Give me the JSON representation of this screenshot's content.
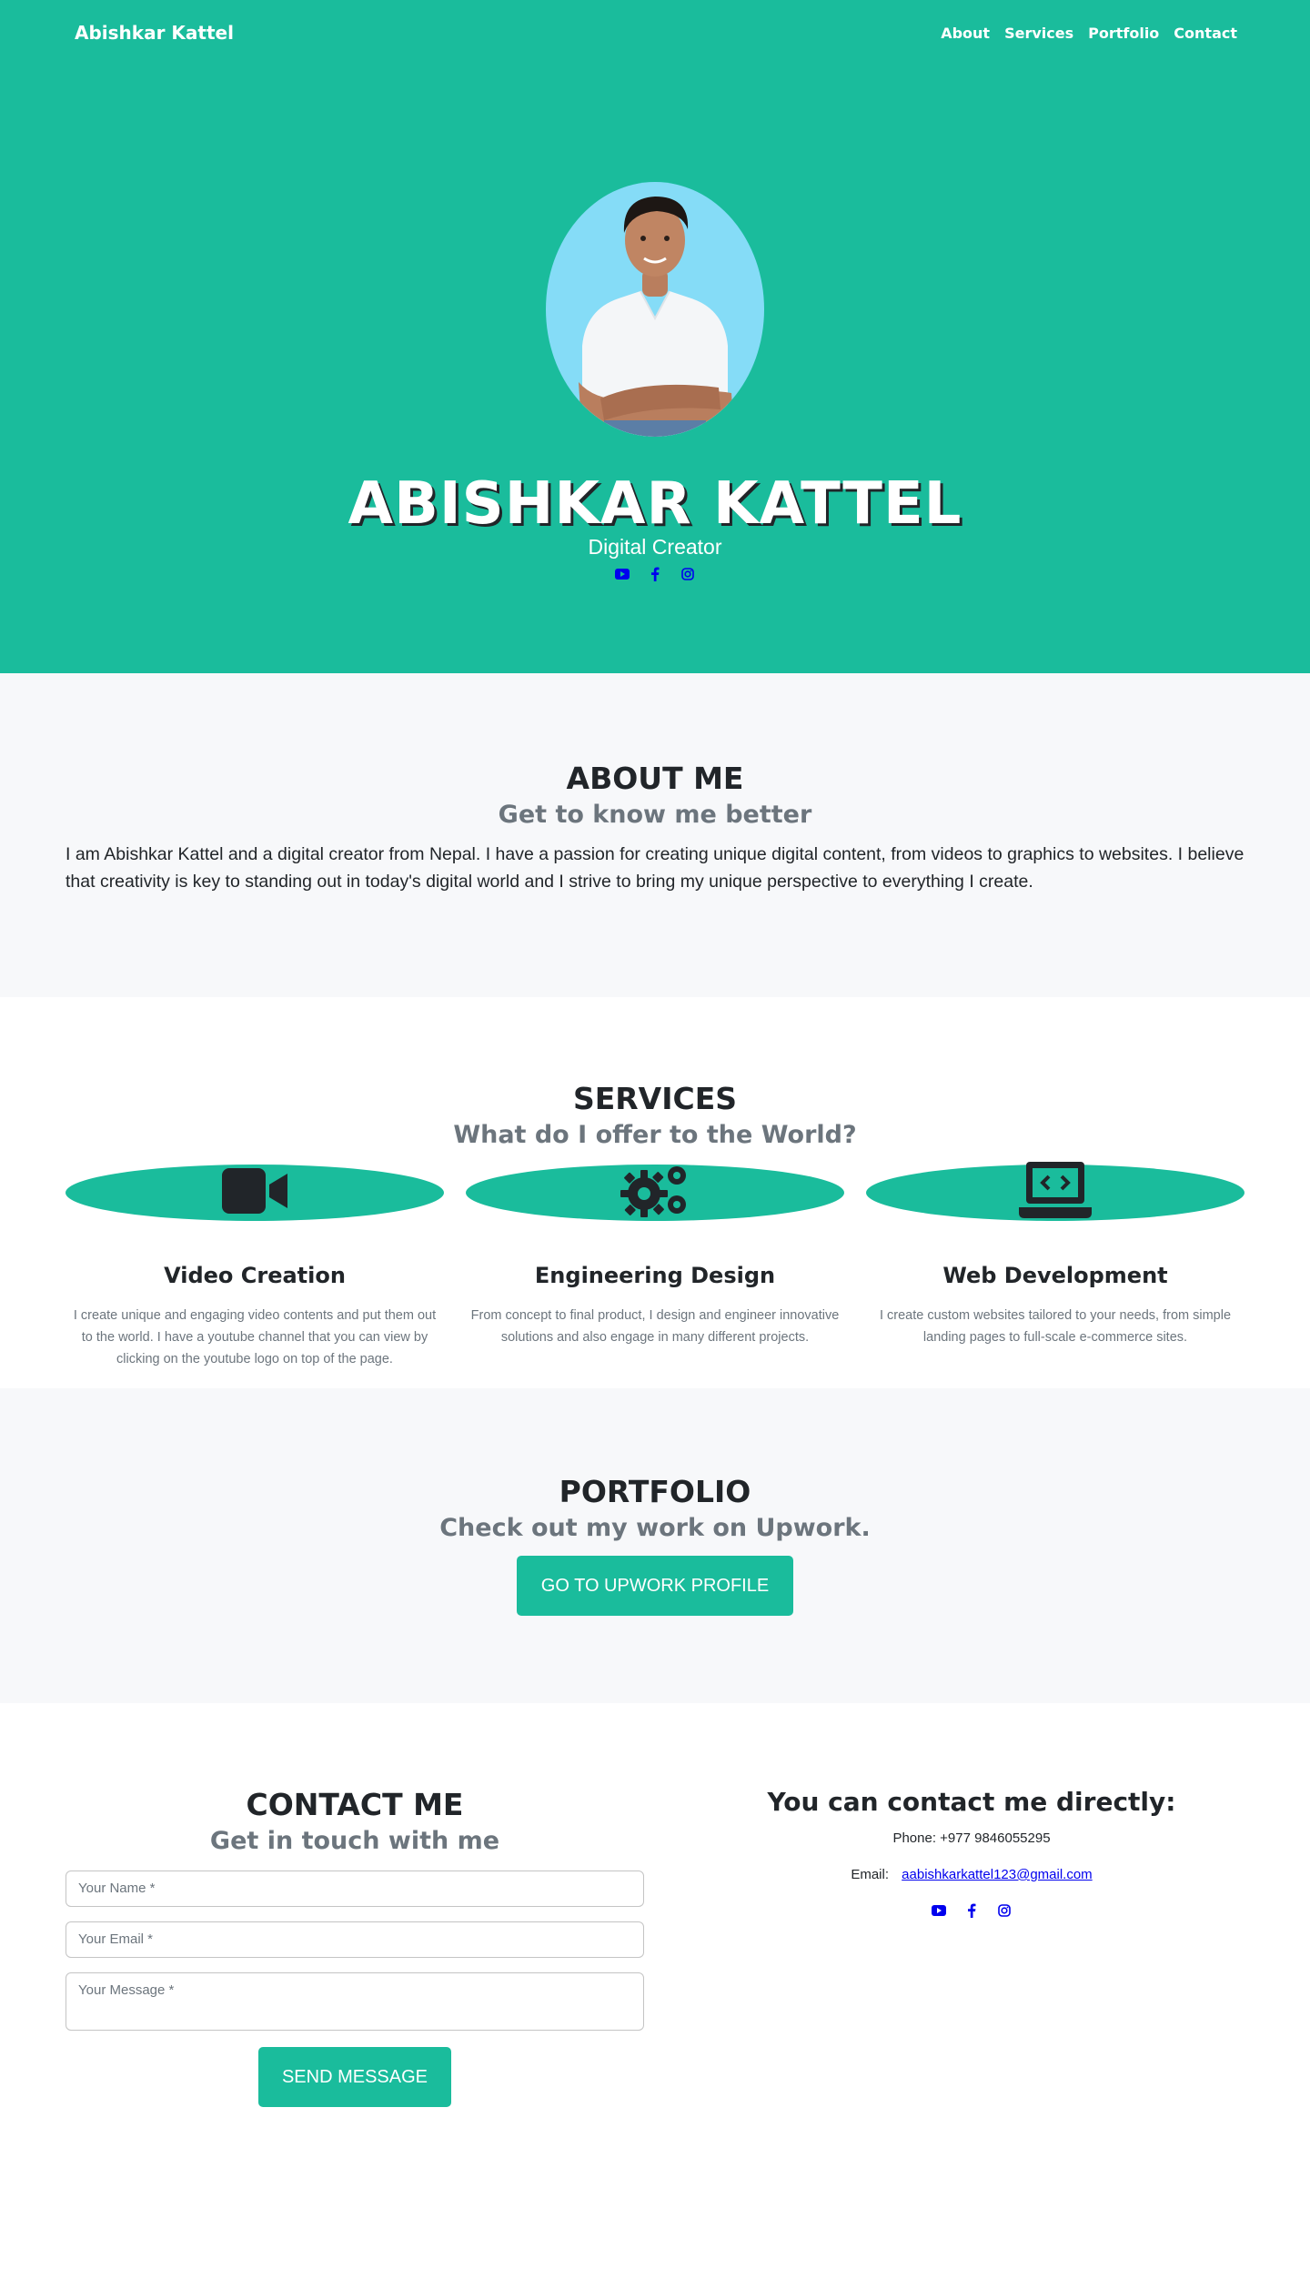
{
  "nav": {
    "brand": "Abishkar Kattel",
    "links": [
      "About",
      "Services",
      "Portfolio",
      "Contact"
    ]
  },
  "hero": {
    "name": "ABISHKAR KATTEL",
    "subtitle": "Digital Creator",
    "social_icons": [
      "youtube-icon",
      "facebook-icon",
      "instagram-icon"
    ]
  },
  "about": {
    "heading": "ABOUT ME",
    "subheading": "Get to know me better",
    "text": "I am Abishkar Kattel and a digital creator from Nepal. I have a passion for creating unique digital content, from videos to graphics to websites. I believe that creativity is key to standing out in today's digital world and I strive to bring my unique perspective to everything I create."
  },
  "services": {
    "heading": "SERVICES",
    "subheading": "What do I offer to the World?",
    "items": [
      {
        "icon": "video-camera-icon",
        "title": "Video Creation",
        "desc": "I create unique and engaging video contents and put them out to the world. I have a youtube channel that you can view by clicking on the youtube logo on top of the page."
      },
      {
        "icon": "gears-icon",
        "title": "Engineering Design",
        "desc": "From concept to final product, I design and engineer innovative solutions and also engage in many different projects."
      },
      {
        "icon": "laptop-code-icon",
        "title": "Web Development",
        "desc": "I create custom websites tailored to your needs, from simple landing pages to full-scale e-commerce sites."
      }
    ]
  },
  "portfolio": {
    "heading": "PORTFOLIO",
    "subheading": "Check out my work on Upwork.",
    "button": "GO TO UPWORK PROFILE"
  },
  "contact": {
    "heading": "CONTACT ME",
    "subheading": "Get in touch with me",
    "name_placeholder": "Your Name *",
    "email_placeholder": "Your Email *",
    "message_placeholder": "Your Message *",
    "button": "SEND MESSAGE",
    "direct_heading": "You can contact me directly:",
    "phone": "Phone: +977 9846055295",
    "email_label": "Email:",
    "email": "aabishkarkattel123@gmail.com"
  },
  "colors": {
    "primary": "#1abc9c",
    "light_bg": "#f7f8fa",
    "dark": "#212529",
    "muted": "#6c757d",
    "link": "#0000ee"
  }
}
